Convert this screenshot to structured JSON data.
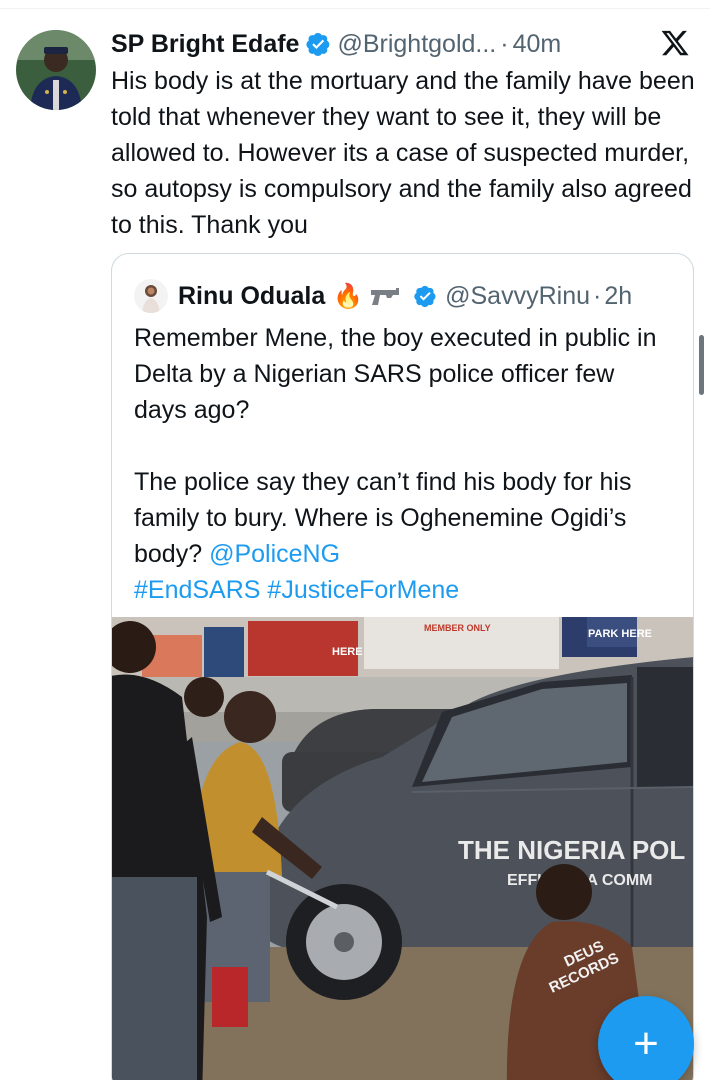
{
  "tweet": {
    "author": {
      "name": "SP Bright Edafe",
      "handle": "@Brightgold...",
      "verified": true,
      "avatar_icon": "police-officer-avatar"
    },
    "separator": "·",
    "time": "40m",
    "platform_icon": "x-logo-icon",
    "text": "His body is at the mortuary and the family have been told that whenever they want to see it, they will be allowed to. However its a case of suspected murder, so autopsy is compulsory and the family also agreed to this. Thank you"
  },
  "quote": {
    "author": {
      "name": "Rinu Oduala",
      "emoji": "🔥",
      "handle": "@SavvyRinu",
      "verified": true,
      "avatar_icon": "person-avatar"
    },
    "separator": "·",
    "time": "2h",
    "paragraph1": "Remember Mene, the boy executed in public in Delta by a Nigerian SARS police officer few days ago?",
    "paragraph2_prefix": "The police say they can’t find his body for his family to bury. Where is Oghenemine Ogidi’s body? ",
    "mention": "@PoliceNG",
    "hashtags": "#EndSARS #JusticeForMene",
    "media": {
      "van_text_line1": "THE NIGERIA POL",
      "van_text_line2": "EFFU      AREA COMM",
      "shirt_text_1": "DEUS",
      "shirt_text_2": "RECORDS",
      "billboard_1": "HERE",
      "billboard_2": "MEMBER ONLY",
      "billboard_3": "PARK HERE"
    }
  },
  "compose_button": {
    "label": "+"
  },
  "colors": {
    "accent": "#1d9bf0",
    "text": "#0f1419",
    "muted": "#536471",
    "border": "#cfd9de"
  }
}
